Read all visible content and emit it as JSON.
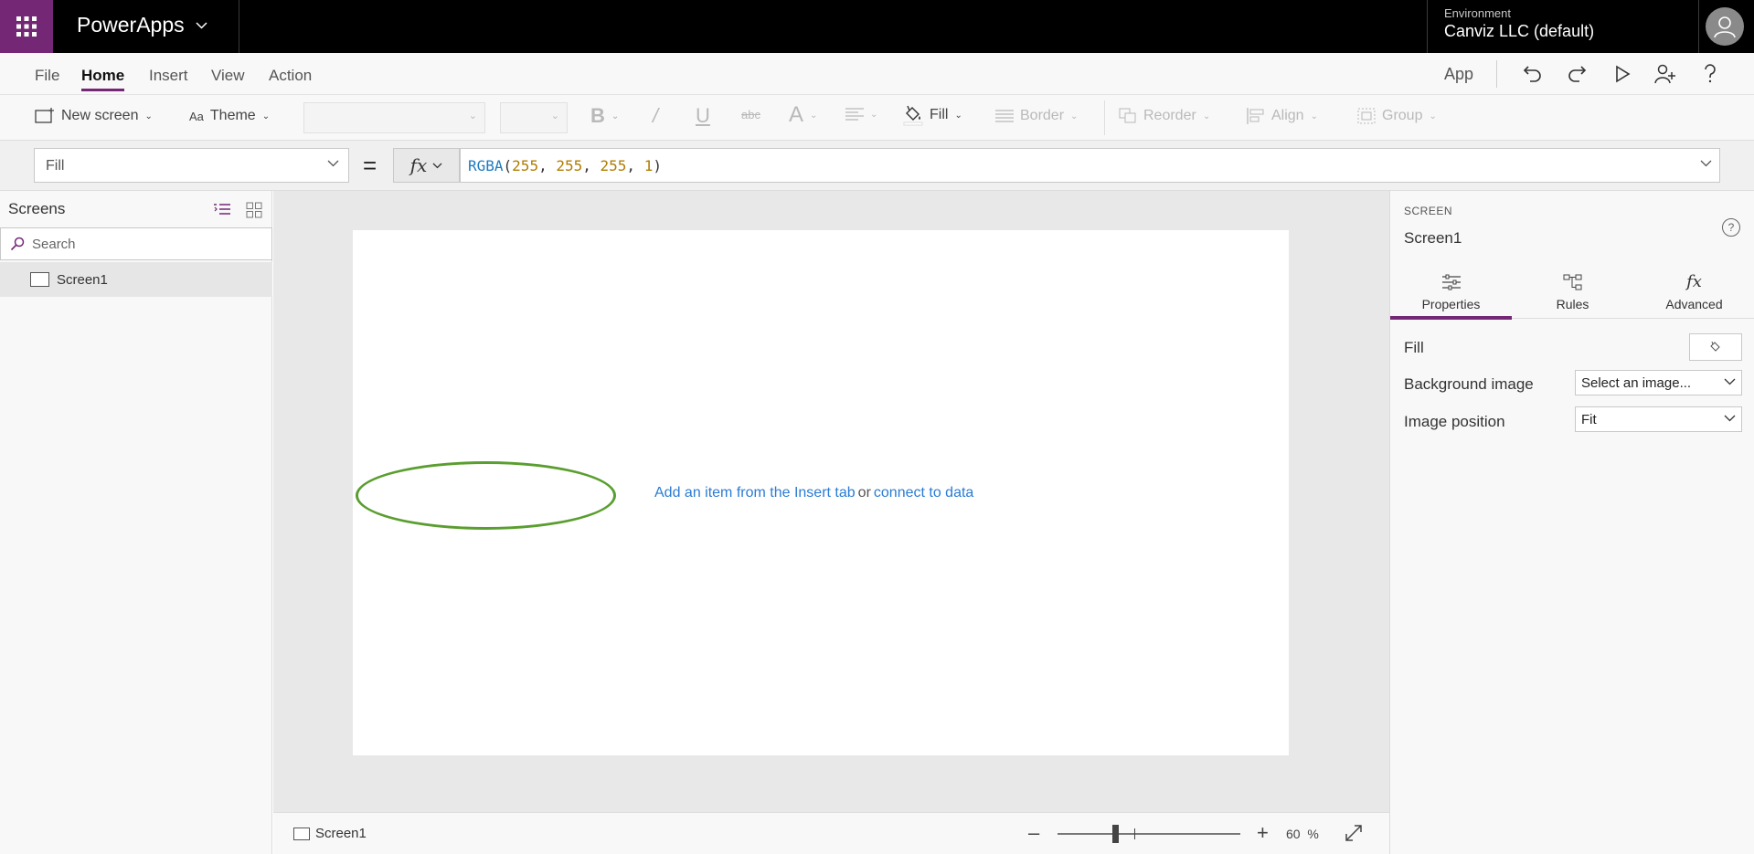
{
  "topbar": {
    "app_name": "PowerApps",
    "environment_label": "Environment",
    "environment_value": "Canviz LLC (default)"
  },
  "menu": {
    "items": [
      "File",
      "Home",
      "Insert",
      "View",
      "Action"
    ],
    "active": "Home",
    "app_label": "App"
  },
  "ribbon": {
    "new_screen": "New screen",
    "theme": "Theme",
    "fill": "Fill",
    "border": "Border",
    "reorder": "Reorder",
    "align": "Align",
    "group": "Group"
  },
  "formula": {
    "property": "Fill",
    "fn": "RGBA",
    "open_paren": "(",
    "r": "255",
    "comma1": ", ",
    "g": "255",
    "comma2": ", ",
    "b": "255",
    "comma3": ", ",
    "a": "1",
    "close_paren": ")"
  },
  "screens_pane": {
    "title": "Screens",
    "search_placeholder": "Search",
    "items": [
      "Screen1"
    ]
  },
  "canvas": {
    "hint_insert": "Add an item from the Insert tab",
    "hint_or": "or",
    "hint_connect": "connect to data"
  },
  "statusbar": {
    "screen": "Screen1",
    "zoom_value": "60",
    "zoom_unit": "%"
  },
  "properties_pane": {
    "kind": "SCREEN",
    "name": "Screen1",
    "tabs": [
      "Properties",
      "Rules",
      "Advanced"
    ],
    "active_tab": "Properties",
    "fill_label": "Fill",
    "fill_color": "#FFFFFF",
    "background_image_label": "Background image",
    "background_image_value": "Select an image...",
    "image_position_label": "Image position",
    "image_position_value": "Fit"
  },
  "colors": {
    "brand": "#742774",
    "link": "#2b7cd3",
    "annotation": "#5a9e2f"
  }
}
